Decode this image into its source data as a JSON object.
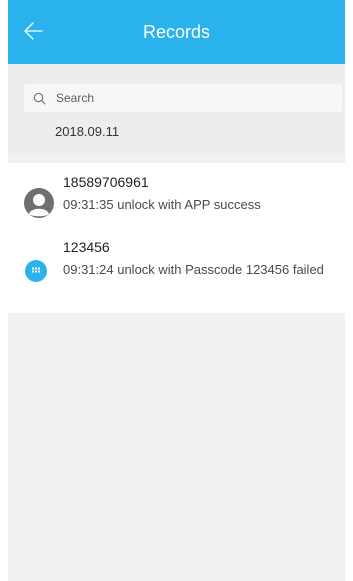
{
  "header": {
    "title": "Records",
    "back_icon": "arrow-left-icon",
    "background_color": "#2ab2ec"
  },
  "search": {
    "placeholder": "Search",
    "icon": "search-icon"
  },
  "date_group": "2018.09.11",
  "records": [
    {
      "title": "18589706961",
      "detail": "09:31:35 unlock with APP success",
      "icon": "user-avatar-icon"
    },
    {
      "title": "123456",
      "detail": "09:31:24 unlock with Passcode 123456 failed",
      "icon": "keypad-icon",
      "icon_color": "#2ab2ec"
    }
  ]
}
